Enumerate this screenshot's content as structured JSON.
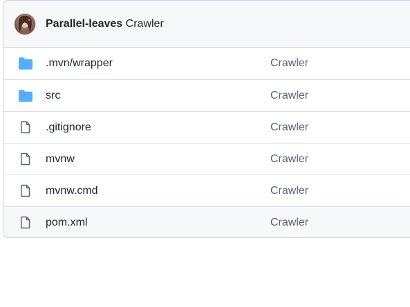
{
  "commit": {
    "author": "Parallel-leaves",
    "message": "Crawler"
  },
  "colors": {
    "folder_icon": "#54aeff",
    "file_icon": "#59636e",
    "border": "#d0d7de",
    "header_bg": "#f6f8fa"
  },
  "files": [
    {
      "name": ".mvn/wrapper",
      "type": "folder",
      "icon": "folder-icon",
      "commit_message": "Crawler"
    },
    {
      "name": "src",
      "type": "folder",
      "icon": "folder-icon",
      "commit_message": "Crawler"
    },
    {
      "name": ".gitignore",
      "type": "file",
      "icon": "file-icon",
      "commit_message": "Crawler"
    },
    {
      "name": "mvnw",
      "type": "file",
      "icon": "file-icon",
      "commit_message": "Crawler"
    },
    {
      "name": "mvnw.cmd",
      "type": "file",
      "icon": "file-icon",
      "commit_message": "Crawler"
    },
    {
      "name": "pom.xml",
      "type": "file",
      "icon": "file-icon",
      "commit_message": "Crawler",
      "highlighted": true
    }
  ]
}
